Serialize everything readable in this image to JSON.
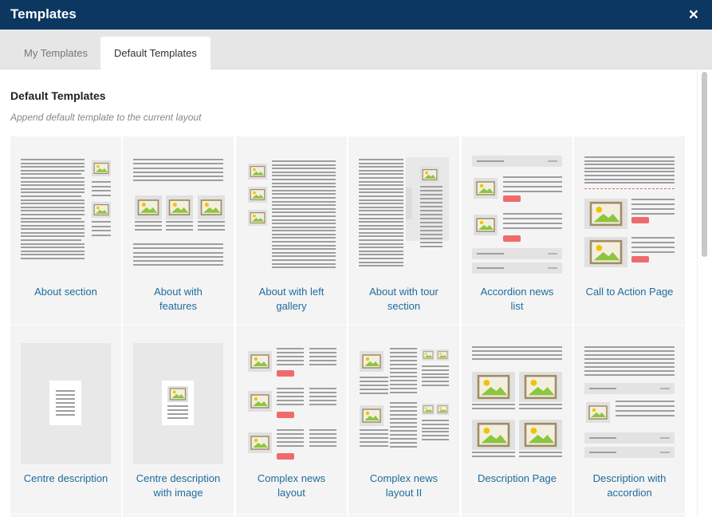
{
  "window": {
    "title": "Templates",
    "close_label": "×"
  },
  "tabs": {
    "my_templates": "My Templates",
    "default_templates": "Default Templates"
  },
  "section": {
    "title": "Default Templates",
    "subtitle": "Append default template to the current layout"
  },
  "templates": [
    {
      "label_line1": "About section",
      "label_line2": ""
    },
    {
      "label_line1": "About with",
      "label_line2": "features"
    },
    {
      "label_line1": "About with left",
      "label_line2": "gallery"
    },
    {
      "label_line1": "About with tour",
      "label_line2": "section"
    },
    {
      "label_line1": "Accordion news",
      "label_line2": "list"
    },
    {
      "label_line1": "Call to Action Page",
      "label_line2": ""
    },
    {
      "label_line1": "Centre description",
      "label_line2": ""
    },
    {
      "label_line1": "Centre description",
      "label_line2": "with image"
    },
    {
      "label_line1": "Complex news",
      "label_line2": "layout"
    },
    {
      "label_line1": "Complex news",
      "label_line2": "layout II"
    },
    {
      "label_line1": "Description Page",
      "label_line2": ""
    },
    {
      "label_line1": "Description with",
      "label_line2": "accordion"
    }
  ],
  "colors": {
    "titlebar": "#0b3761",
    "label": "#1f6b9c",
    "accent_pill": "#ef6b6b",
    "image_sky": "#d9d2b8",
    "image_sun": "#f2c200",
    "image_hill": "#8cc63f"
  }
}
